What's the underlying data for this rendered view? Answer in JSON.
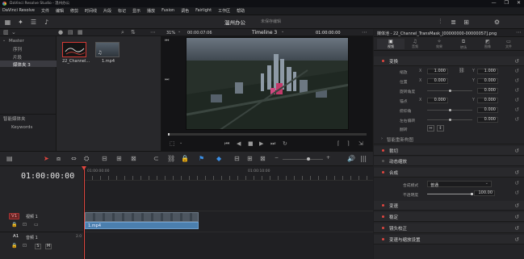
{
  "app": {
    "window_title": "DaVinci Resolve Studio - 温州办公",
    "window_controls": [
      "—",
      "❐",
      "✕"
    ]
  },
  "menu": [
    "DaVinci Resolve",
    "文件",
    "编辑",
    "修剪",
    "时间线",
    "片段",
    "标记",
    "显示",
    "播放",
    "Fusion",
    "调色",
    "Fairlight",
    "工作区",
    "帮助"
  ],
  "project": {
    "name": "温州办公",
    "status": "未保存编辑"
  },
  "toolbar_icons": [
    "media-pool-icon",
    "effects-icon",
    "edit-index-icon",
    "sound-library-icon",
    "mixer-icon",
    "metadata-icon",
    "inspector-icon"
  ],
  "media_pool": {
    "bins": {
      "master": "Master",
      "items": [
        "序列",
        "片段",
        "媒体夹 3"
      ],
      "selected_index": 2
    },
    "smart_bins_title": "智能媒体夹",
    "smart_bins_items": [
      "Keywords"
    ],
    "clips": [
      {
        "name": "22_Channel...",
        "selected": true
      },
      {
        "name": "1.mp4",
        "selected": false
      }
    ]
  },
  "viewer": {
    "zoom": "31%",
    "source_tc": "00:00:07:06",
    "timeline_name": "Timeline 3",
    "record_tc": "01:00:00:00"
  },
  "inspector": {
    "title": "媒体池 - 22_Channel_TransMask_[00000000-00000057].png",
    "tabs": [
      {
        "label": "视频",
        "icon": "video-icon"
      },
      {
        "label": "音频",
        "icon": "audio-icon"
      },
      {
        "label": "效果",
        "icon": "effects-icon"
      },
      {
        "label": "转场",
        "icon": "transition-icon"
      },
      {
        "label": "图像",
        "icon": "image-icon"
      },
      {
        "label": "文件",
        "icon": "file-icon"
      }
    ],
    "transform": {
      "label": "变换",
      "zoom": {
        "label": "缩放",
        "x": "1.000",
        "y": "1.000"
      },
      "position": {
        "label": "位置",
        "x": "0.000",
        "y": "0.000"
      },
      "rotation": {
        "label": "旋转角度",
        "value": "0.000"
      },
      "anchor": {
        "label": "锚点",
        "x": "0.000",
        "y": "0.000"
      },
      "pitch": {
        "label": "俯仰角",
        "value": "0.000"
      },
      "yaw": {
        "label": "左右偏转",
        "value": "0.000"
      },
      "flip": {
        "label": "翻转"
      }
    },
    "smart_reframe": "智能重新构图",
    "sections": [
      {
        "label": "裁切",
        "active": true
      },
      {
        "label": "动态缩放",
        "active": false
      },
      {
        "label": "合成",
        "active": true
      },
      {
        "label": "变速",
        "active": true
      },
      {
        "label": "稳定",
        "active": true
      },
      {
        "label": "镜头校正",
        "active": true
      },
      {
        "label": "变速与缩放设置",
        "active": true
      }
    ],
    "composite": {
      "mode_label": "合成模式",
      "mode_value": "普通",
      "opacity_label": "不透明度",
      "opacity_value": "100.00"
    }
  },
  "timeline": {
    "timecode": "01:00:00:00",
    "ruler_labels": [
      "01:00:00:00",
      "01:00:10:00"
    ],
    "tracks": [
      {
        "id": "V1",
        "name": "视频 1"
      },
      {
        "id": "A1",
        "name": "音频 1",
        "channel": "2.0"
      }
    ],
    "clip_label": "1.mp4",
    "audio_buttons": [
      "S",
      "M"
    ]
  },
  "colors": {
    "accent": "#e0463f",
    "clip": "#4b7fae",
    "background": "#1e1e20"
  }
}
